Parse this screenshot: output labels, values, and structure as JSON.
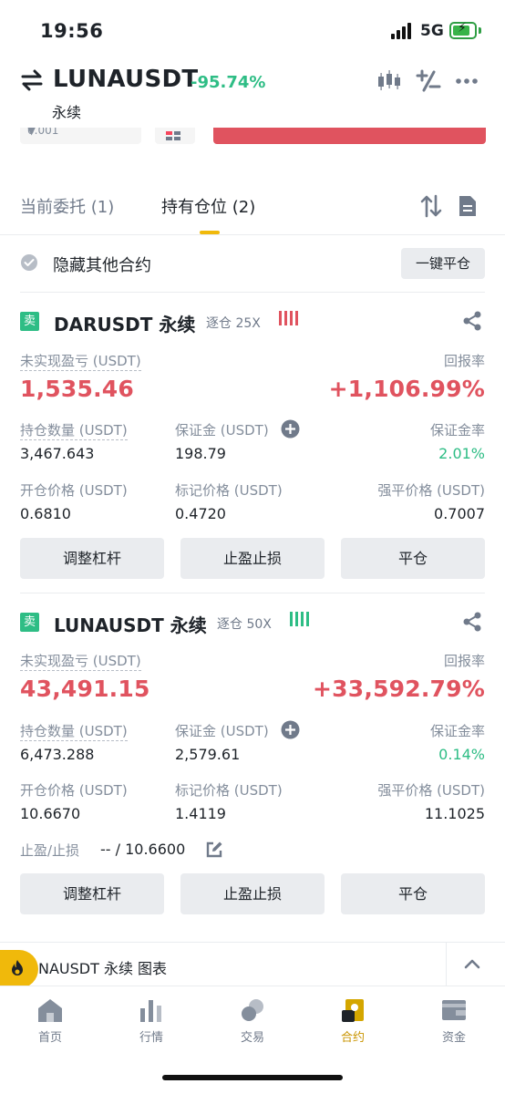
{
  "status_bar": {
    "time": "19:56",
    "network": "5G"
  },
  "header": {
    "symbol": "LUNAUSDT",
    "change": "-95.74%",
    "contract_type": "永续"
  },
  "peek": {
    "amount_value": "0.001"
  },
  "tabs": {
    "open_orders": "当前委托 (1)",
    "positions": "持有仓位 (2)"
  },
  "hide_row": {
    "label": "隐藏其他合约",
    "close_all": "一键平仓"
  },
  "positions": [
    {
      "side": "卖",
      "symbol": "DARUSDT 永续",
      "margin_mode": "逐仓 25X",
      "pnl_label": "未实现盈亏 (USDT)",
      "pnl": "1,535.46",
      "roe_label": "回报率",
      "roe": "+1,106.99%",
      "size_label": "持仓数量 (USDT)",
      "size": "3,467.643",
      "margin_label": "保证金 (USDT)",
      "margin": "198.79",
      "margin_ratio_label": "保证金率",
      "margin_ratio": "2.01%",
      "entry_label": "开仓价格 (USDT)",
      "entry": "0.6810",
      "mark_label": "标记价格 (USDT)",
      "mark": "0.4720",
      "liq_label": "强平价格 (USDT)",
      "liq": "0.7007",
      "buttons": {
        "leverage": "调整杠杆",
        "tpsl": "止盈止损",
        "close": "平仓"
      }
    },
    {
      "side": "卖",
      "symbol": "LUNAUSDT 永续",
      "margin_mode": "逐仓 50X",
      "pnl_label": "未实现盈亏 (USDT)",
      "pnl": "43,491.15",
      "roe_label": "回报率",
      "roe": "+33,592.79%",
      "size_label": "持仓数量 (USDT)",
      "size": "6,473.288",
      "margin_label": "保证金 (USDT)",
      "margin": "2,579.61",
      "margin_ratio_label": "保证金率",
      "margin_ratio": "0.14%",
      "entry_label": "开仓价格 (USDT)",
      "entry": "10.6670",
      "mark_label": "标记价格 (USDT)",
      "mark": "1.4119",
      "liq_label": "强平价格 (USDT)",
      "liq": "11.1025",
      "tpsl_label": "止盈/止损",
      "tpsl_value": "-- / 10.6600",
      "buttons": {
        "leverage": "调整杠杆",
        "tpsl": "止盈止损",
        "close": "平仓"
      }
    }
  ],
  "chart_bar": {
    "label": "NAUSDT 永续  图表"
  },
  "tabbar": {
    "items": [
      {
        "label": "首页",
        "icon": "home-icon"
      },
      {
        "label": "行情",
        "icon": "markets-icon"
      },
      {
        "label": "交易",
        "icon": "trade-icon"
      },
      {
        "label": "合约",
        "icon": "futures-icon"
      },
      {
        "label": "资金",
        "icon": "wallet-icon"
      }
    ],
    "active": "合约"
  },
  "colors": {
    "accent": "#f0b90b",
    "up": "#2ebd85",
    "down": "#e0535f",
    "muted": "#848e9c"
  }
}
